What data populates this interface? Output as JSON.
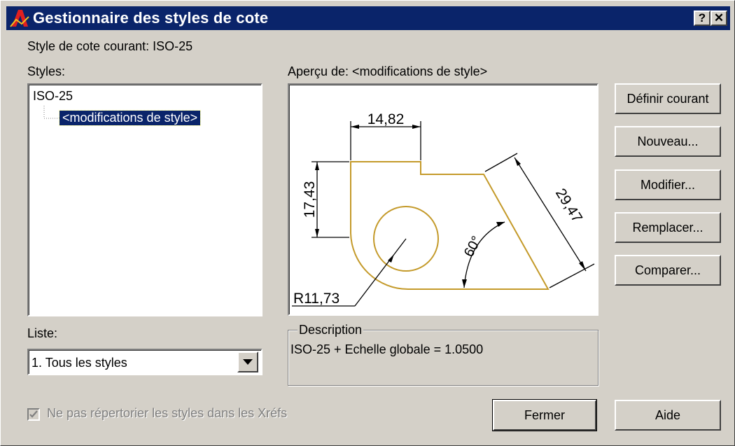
{
  "titlebar": {
    "title": "Gestionnaire des styles de cote",
    "help_label": "?",
    "close_label": "✕"
  },
  "current_style": "Style de cote courant: ISO-25",
  "styles_panel": {
    "label": "Styles:",
    "items": [
      "ISO-25",
      "<modifications de style>"
    ]
  },
  "preview": {
    "label": "Aperçu de: <modifications de style>",
    "dims": {
      "width": "14,82",
      "height": "17,43",
      "diagonal": "29,47",
      "angle": "60°",
      "radius": "R11,73"
    },
    "line_color": "#c49a2a"
  },
  "list": {
    "label": "Liste:",
    "selected": "1. Tous les styles"
  },
  "description": {
    "label": "Description",
    "text": "ISO-25 + Echelle globale = 1.0500"
  },
  "checkbox": {
    "label": "Ne pas répertorier les styles dans les Xréfs",
    "checked": true,
    "disabled": true
  },
  "buttons": {
    "set_current": "Définir courant",
    "new": "Nouveau...",
    "modify": "Modifier...",
    "override": "Remplacer...",
    "compare": "Comparer...",
    "close": "Fermer",
    "help": "Aide"
  }
}
